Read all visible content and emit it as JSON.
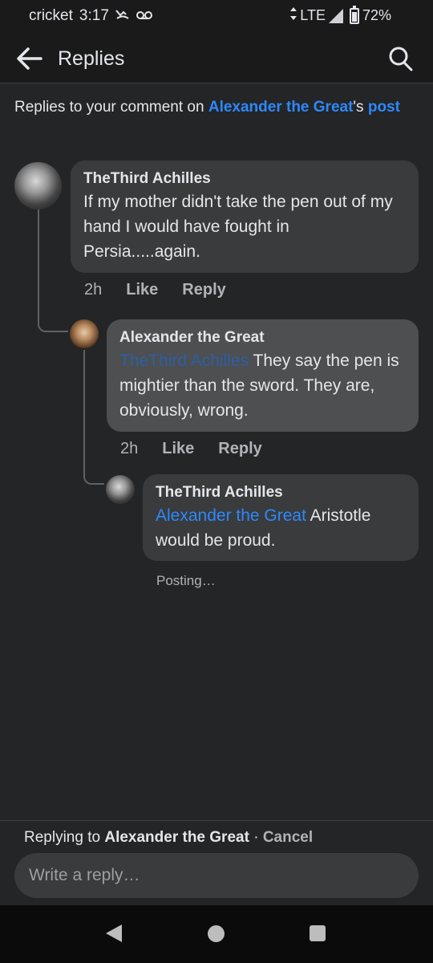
{
  "status_bar": {
    "carrier": "cricket",
    "time": "3:17",
    "network": "LTE",
    "battery": "72%"
  },
  "header": {
    "title": "Replies"
  },
  "intro": {
    "prefix": "Replies to your comment on ",
    "author_link": "Alexander the Great",
    "suffix": "'s",
    "post_link": "post"
  },
  "comments": [
    {
      "author": "TheThird Achilles",
      "mention": "",
      "text": "If my mother didn't take the pen out of my hand I would have fought in Persia.....again.",
      "time": "2h",
      "like_label": "Like",
      "reply_label": "Reply"
    },
    {
      "author": "Alexander the Great",
      "mention": "TheThird Achilles",
      "text": " They say the pen is mightier than the sword. They are, obviously, wrong.",
      "time": "2h",
      "like_label": "Like",
      "reply_label": "Reply"
    },
    {
      "author": "TheThird Achilles",
      "mention": "Alexander the Great",
      "text": " Aristotle would be proud.",
      "status": "Posting…"
    }
  ],
  "composer": {
    "replying_prefix": "Replying to ",
    "replying_to": "Alexander the Great",
    "separator": " · ",
    "cancel_label": "Cancel",
    "placeholder": "Write a reply…"
  },
  "colors": {
    "background": "#242526",
    "bubble": "#3a3b3c",
    "bubble_highlight": "#4e4f50",
    "link": "#2d88ff",
    "secondary_text": "#b0b3b8"
  },
  "icons": {
    "back": "arrow-left-icon",
    "search": "search-icon",
    "nav_back": "triangle-back-icon",
    "nav_home": "circle-home-icon",
    "nav_recents": "square-recents-icon"
  }
}
